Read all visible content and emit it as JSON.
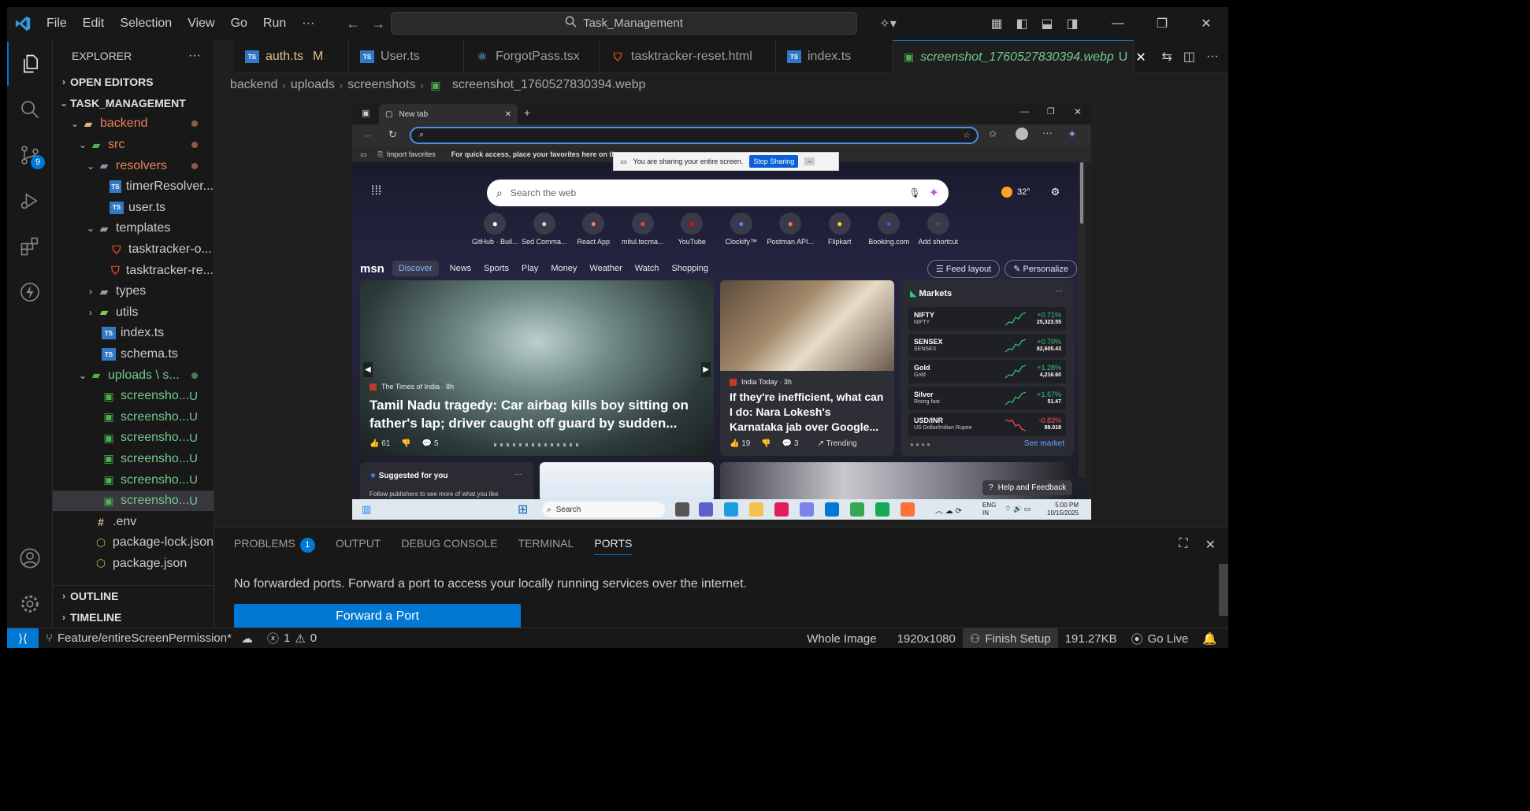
{
  "titlebar": {
    "menu": [
      "File",
      "Edit",
      "Selection",
      "View",
      "Go",
      "Run",
      "···"
    ],
    "search": "Task_Management"
  },
  "activity": {
    "source_control_badge": "9"
  },
  "explorer": {
    "title": "EXPLORER",
    "open_editors": "OPEN EDITORS",
    "project": "TASK_MANAGEMENT",
    "backend": "backend",
    "src": "src",
    "resolvers": "resolvers",
    "timerResolver": "timerResolver...",
    "user_ts": "user.ts",
    "templates": "templates",
    "tmpl1": "tasktracker-o...",
    "tmpl2": "tasktracker-re...",
    "types": "types",
    "utils": "utils",
    "index_ts": "index.ts",
    "schema_ts": "schema.ts",
    "uploads": "uploads \\ s...",
    "screenshots": [
      "screensho...",
      "screensho...",
      "screensho...",
      "screensho...",
      "screensho...",
      "screensho..."
    ],
    "untracked_mark": "U",
    "env": ".env",
    "pkg_lock": "package-lock.json",
    "pkg": "package.json",
    "outline": "OUTLINE",
    "timeline": "TIMELINE"
  },
  "tabs": [
    {
      "label": "auth.ts",
      "badge": "M"
    },
    {
      "label": "User.ts"
    },
    {
      "label": "ForgotPass.tsx"
    },
    {
      "label": "tasktracker-reset.html"
    },
    {
      "label": "index.ts"
    },
    {
      "label": "screenshot_1760527830394.webp",
      "badge": "U"
    }
  ],
  "breadcrumb": [
    "backend",
    "uploads",
    "screenshots",
    "screenshot_1760527830394.webp"
  ],
  "screenshot": {
    "tab_title": "New tab",
    "import_favorites": "Import favorites",
    "fav_hint": "For quick access, place your favorites here on the",
    "share_msg": "You are sharing your entire screen.",
    "stop_sharing": "Stop Sharing",
    "search_placeholder": "Search the web",
    "temperature": "32°",
    "shortcuts": [
      "GitHub · Buil...",
      "Sed Comma...",
      "React App",
      "mitul.tecma...",
      "YouTube",
      "Clockify™",
      "Postman API...",
      "Flipkart",
      "Booking.com",
      "Add shortcut"
    ],
    "shortcut_colors": [
      "#ffffff",
      "#cfcfcf",
      "#e8835a",
      "#ea4335",
      "#ff0000",
      "#3a86ff",
      "#ff6c37",
      "#f7d400",
      "#2b5fd6",
      "#555566"
    ],
    "msn": "msn",
    "discover": "Discover",
    "nav": [
      "News",
      "Sports",
      "Play",
      "Money",
      "Weather",
      "Watch",
      "Shopping"
    ],
    "feed_layout": "Feed layout",
    "personalize": "Personalize",
    "hero": {
      "source": "The Times of India · 8h",
      "title": "Tamil Nadu tragedy: Car airbag kills boy sitting on father's lap; driver caught off guard by sudden...",
      "likes": "61",
      "comments": "5"
    },
    "news2": {
      "source": "India Today · 3h",
      "title": "If they're inefficient, what can I do: Nara Lokesh's Karnataka jab over Google...",
      "likes": "19",
      "comments": "3",
      "trending": "Trending"
    },
    "markets": {
      "title": "Markets",
      "rows": [
        {
          "name": "NIFTY",
          "sub": "NIFTY",
          "change": "+0.71%",
          "value": "25,323.55",
          "up": true
        },
        {
          "name": "SENSEX",
          "sub": "SENSEX",
          "change": "+0.70%",
          "value": "82,605.43",
          "up": true
        },
        {
          "name": "Gold",
          "sub": "Gold",
          "change": "+1.28%",
          "value": "4,216.60",
          "up": true
        },
        {
          "name": "Silver",
          "sub": "Rising fast",
          "change": "+1.67%",
          "value": "51.47",
          "up": true
        },
        {
          "name": "USD/INR",
          "sub": "US Dollar/Indian Rupee",
          "change": "-0.83%",
          "value": "88.018",
          "up": false
        }
      ],
      "see_market": "See market"
    },
    "suggested": "Suggested for you",
    "follow_hint": "Follow publishers to see more of what you like",
    "help": "Help and Feedback",
    "taskbar": {
      "search": "Search",
      "lang": "ENG\nIN",
      "time": "5:00 PM",
      "date": "10/15/2025"
    }
  },
  "panel": {
    "tabs": [
      "PROBLEMS",
      "OUTPUT",
      "DEBUG CONSOLE",
      "TERMINAL",
      "PORTS"
    ],
    "problems_badge": "1",
    "message": "No forwarded ports. Forward a port to access your locally running services over the internet.",
    "forward_button": "Forward a Port"
  },
  "status": {
    "branch": "Feature/entireScreenPermission*",
    "errors": "1",
    "warnings": "0",
    "whole_image": "Whole Image",
    "dimensions": "1920x1080",
    "finish_setup": "Finish Setup",
    "size": "191.27KB",
    "go_live": "Go Live"
  },
  "colors": {
    "accent": "#0078d4",
    "untracked": "#73c991",
    "modified": "#e2c08d"
  }
}
